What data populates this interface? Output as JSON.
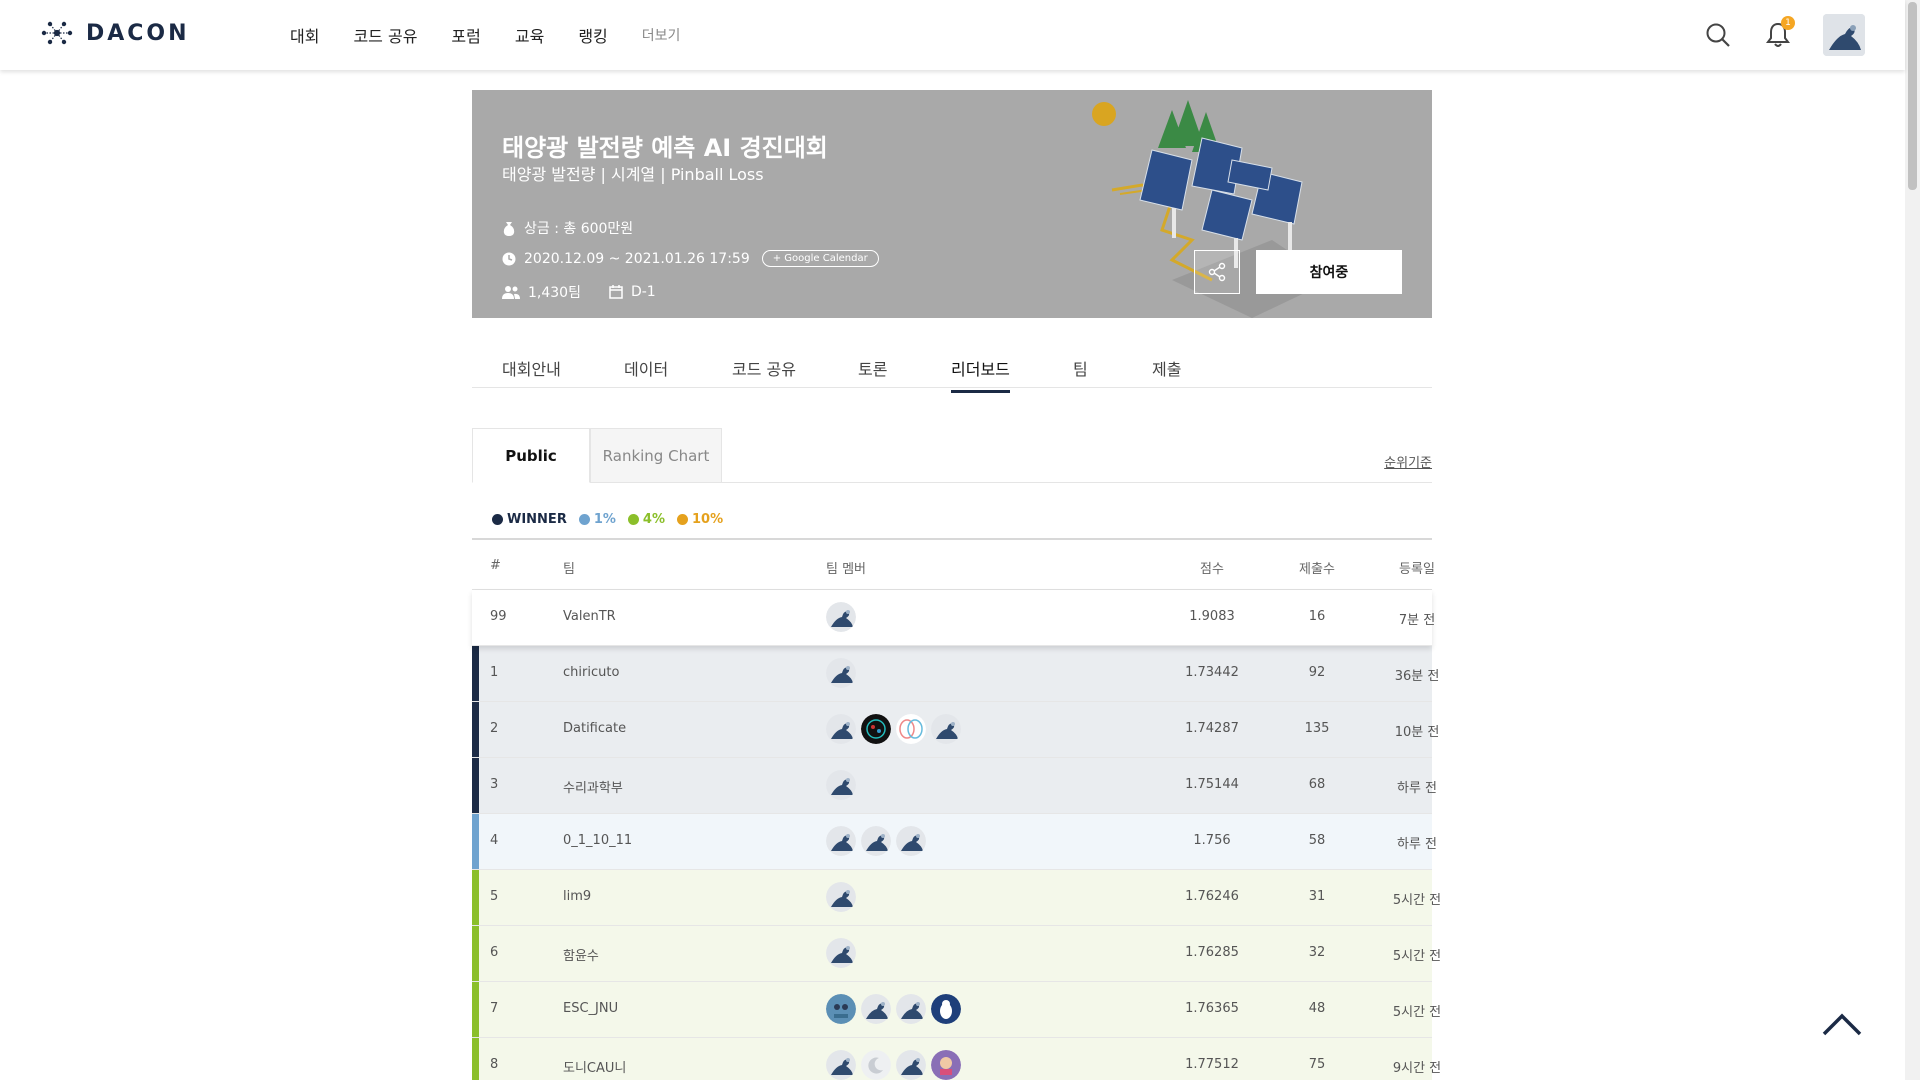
{
  "header": {
    "logo_text": "DACON",
    "nav": [
      "대회",
      "코드 공유",
      "포럼",
      "교육",
      "랭킹"
    ],
    "nav_more": "더보기",
    "notification_count": "1"
  },
  "banner": {
    "title": "태양광 발전량 예측 AI 경진대회",
    "subtitle": "태양광 발전량 | 시계열 | Pinball Loss",
    "prize": "상금 : 총 600만원",
    "period": "2020.12.09 ~ 2021.01.26 17:59",
    "google_calendar": "+ Google Calendar",
    "teams": "1,430팀",
    "dday": "D-1",
    "join_label": "참여중"
  },
  "tabs": [
    "대회안내",
    "데이터",
    "코드 공유",
    "토론",
    "리더보드",
    "팀",
    "제출"
  ],
  "active_tab": "리더보드",
  "subtabs": {
    "public": "Public",
    "ranking_chart": "Ranking Chart",
    "rank_basis": "순위기준"
  },
  "legend": [
    {
      "label": "WINNER",
      "color": "#1b2a45"
    },
    {
      "label": "1%",
      "color": "#6fa3cf"
    },
    {
      "label": "4%",
      "color": "#8bbf2a"
    },
    {
      "label": "10%",
      "color": "#e5a11d"
    }
  ],
  "table": {
    "headers": [
      "#",
      "팀",
      "팀 멤버",
      "점수",
      "제출수",
      "등록일"
    ],
    "rows": [
      {
        "rank": "99",
        "team": "ValenTR",
        "members": [
          "default"
        ],
        "score": "1.9083",
        "subs": "16",
        "date": "7분 전",
        "tier": "me"
      },
      {
        "rank": "1",
        "team": "chiricuto",
        "members": [
          "default"
        ],
        "score": "1.73442",
        "subs": "92",
        "date": "36분 전",
        "tier": "winner"
      },
      {
        "rank": "2",
        "team": "Datificate",
        "members": [
          "default",
          "dark",
          "brain",
          "default"
        ],
        "score": "1.74287",
        "subs": "135",
        "date": "10분 전",
        "tier": "winner"
      },
      {
        "rank": "3",
        "team": "수리과학부",
        "members": [
          "default"
        ],
        "score": "1.75144",
        "subs": "68",
        "date": "하루 전",
        "tier": "winner"
      },
      {
        "rank": "4",
        "team": "0_1_10_11",
        "members": [
          "default",
          "default",
          "default"
        ],
        "score": "1.756",
        "subs": "58",
        "date": "하루 전",
        "tier": "p1"
      },
      {
        "rank": "5",
        "team": "lim9",
        "members": [
          "default"
        ],
        "score": "1.76246",
        "subs": "31",
        "date": "5시간 전",
        "tier": "p4"
      },
      {
        "rank": "6",
        "team": "함윤수",
        "members": [
          "default"
        ],
        "score": "1.76285",
        "subs": "32",
        "date": "5시간 전",
        "tier": "p4"
      },
      {
        "rank": "7",
        "team": "ESC_JNU",
        "members": [
          "blue",
          "default",
          "default",
          "penguin"
        ],
        "score": "1.76365",
        "subs": "48",
        "date": "5시간 전",
        "tier": "p4"
      },
      {
        "rank": "8",
        "team": "도니CAU니",
        "members": [
          "default",
          "moon",
          "default",
          "purple"
        ],
        "score": "1.77512",
        "subs": "75",
        "date": "9시간 전",
        "tier": "p4"
      }
    ]
  },
  "tier_styles": {
    "me": {
      "bg": "#ffffff",
      "bar": ""
    },
    "winner": {
      "bg": "#eaedf0",
      "bar": "#1b2a45"
    },
    "p1": {
      "bg": "#f1f6fa",
      "bar": "#6fa3cf"
    },
    "p4": {
      "bg": "#f4f8ea",
      "bar": "#8bbf2a"
    }
  }
}
